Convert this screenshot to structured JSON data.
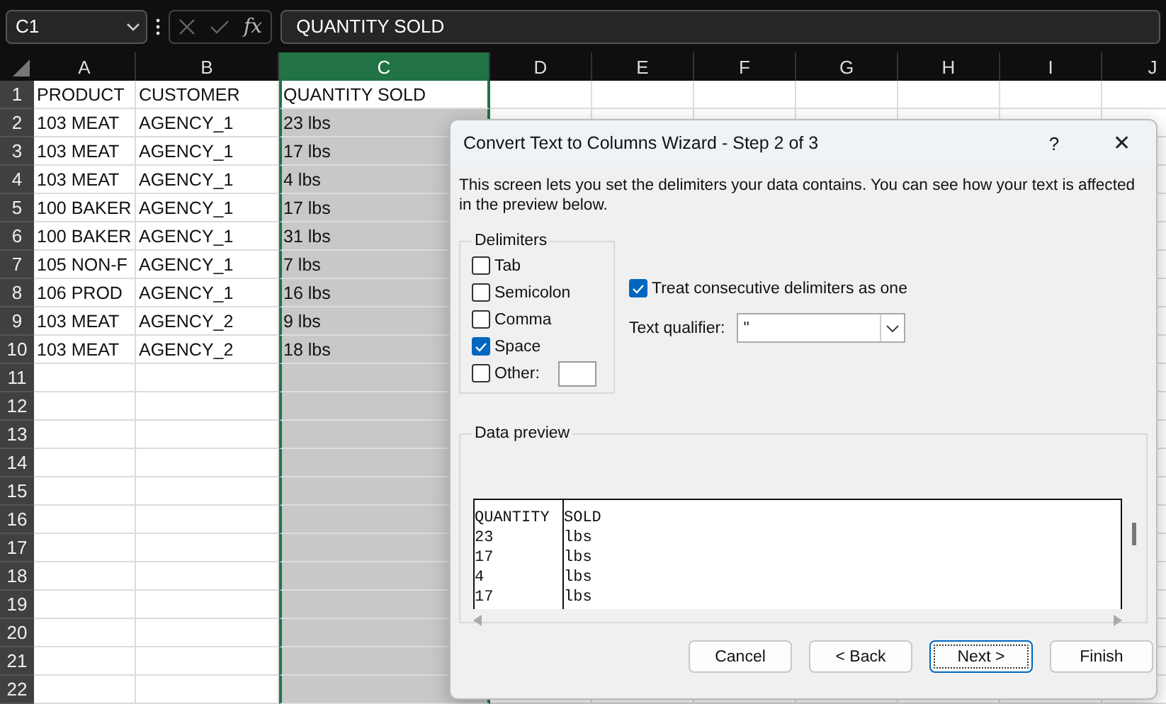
{
  "formula_bar": {
    "name_box": "C1",
    "fx": "fx",
    "content": "QUANTITY SOLD"
  },
  "sheet": {
    "columns": [
      {
        "label": "A",
        "selected": false
      },
      {
        "label": "B",
        "selected": false
      },
      {
        "label": "C",
        "selected": true
      },
      {
        "label": "D",
        "selected": false
      },
      {
        "label": "E",
        "selected": false
      },
      {
        "label": "F",
        "selected": false
      },
      {
        "label": "G",
        "selected": false
      },
      {
        "label": "H",
        "selected": false
      },
      {
        "label": "I",
        "selected": false
      },
      {
        "label": "J",
        "selected": false
      }
    ],
    "rows": [
      {
        "number": "1",
        "active": true,
        "cells": [
          "PRODUCT",
          "CUSTOMER",
          "QUANTITY SOLD"
        ]
      },
      {
        "number": "2",
        "active": false,
        "cells": [
          "103 MEAT",
          "AGENCY_1",
          "23 lbs"
        ]
      },
      {
        "number": "3",
        "active": false,
        "cells": [
          "103 MEAT",
          "AGENCY_1",
          "17 lbs"
        ]
      },
      {
        "number": "4",
        "active": false,
        "cells": [
          "103 MEAT",
          "AGENCY_1",
          "4 lbs"
        ]
      },
      {
        "number": "5",
        "active": false,
        "cells": [
          "100 BAKER",
          "AGENCY_1",
          "17 lbs"
        ]
      },
      {
        "number": "6",
        "active": false,
        "cells": [
          "100 BAKER",
          "AGENCY_1",
          "31 lbs"
        ]
      },
      {
        "number": "7",
        "active": false,
        "cells": [
          "105 NON-F",
          "AGENCY_1",
          "7 lbs"
        ]
      },
      {
        "number": "8",
        "active": false,
        "cells": [
          "106 PROD",
          "AGENCY_1",
          "16 lbs"
        ]
      },
      {
        "number": "9",
        "active": false,
        "cells": [
          "103 MEAT",
          "AGENCY_2",
          "9 lbs"
        ]
      },
      {
        "number": "10",
        "active": false,
        "cells": [
          "103 MEAT",
          "AGENCY_2",
          "18 lbs"
        ]
      },
      {
        "number": "11",
        "active": false,
        "cells": []
      },
      {
        "number": "12",
        "active": false,
        "cells": []
      },
      {
        "number": "13",
        "active": false,
        "cells": []
      },
      {
        "number": "14",
        "active": false,
        "cells": []
      },
      {
        "number": "15",
        "active": false,
        "cells": []
      },
      {
        "number": "16",
        "active": false,
        "cells": []
      },
      {
        "number": "17",
        "active": false,
        "cells": []
      },
      {
        "number": "18",
        "active": false,
        "cells": []
      },
      {
        "number": "19",
        "active": false,
        "cells": []
      },
      {
        "number": "20",
        "active": false,
        "cells": []
      },
      {
        "number": "21",
        "active": false,
        "cells": []
      },
      {
        "number": "22",
        "active": false,
        "cells": []
      }
    ]
  },
  "dialog": {
    "title": "Convert Text to Columns Wizard - Step 2 of 3",
    "help": "?",
    "close": "✕",
    "description": "This screen lets you set the delimiters your data contains.  You can see how your text is affected in the preview below.",
    "delimiters": {
      "legend": "Delimiters",
      "items": [
        {
          "label": "Tab",
          "checked": false
        },
        {
          "label": "Semicolon",
          "checked": false
        },
        {
          "label": "Comma",
          "checked": false
        },
        {
          "label": "Space",
          "checked": true
        },
        {
          "label": "Other:",
          "checked": false
        }
      ]
    },
    "consecutive": {
      "label": "Treat consecutive delimiters as one",
      "checked": true
    },
    "qualifier": {
      "label": "Text qualifier:",
      "value": "\""
    },
    "preview": {
      "legend": "Data preview",
      "rows": [
        [
          "QUANTITY",
          "SOLD"
        ],
        [
          "23",
          "lbs"
        ],
        [
          "17",
          "lbs"
        ],
        [
          "4",
          "lbs"
        ],
        [
          "17",
          "lbs"
        ]
      ]
    },
    "buttons": [
      {
        "label": "Cancel",
        "focused": false
      },
      {
        "label": "< Back",
        "focused": false
      },
      {
        "label": "Next >",
        "focused": true
      },
      {
        "label": "Finish",
        "focused": false
      }
    ]
  }
}
